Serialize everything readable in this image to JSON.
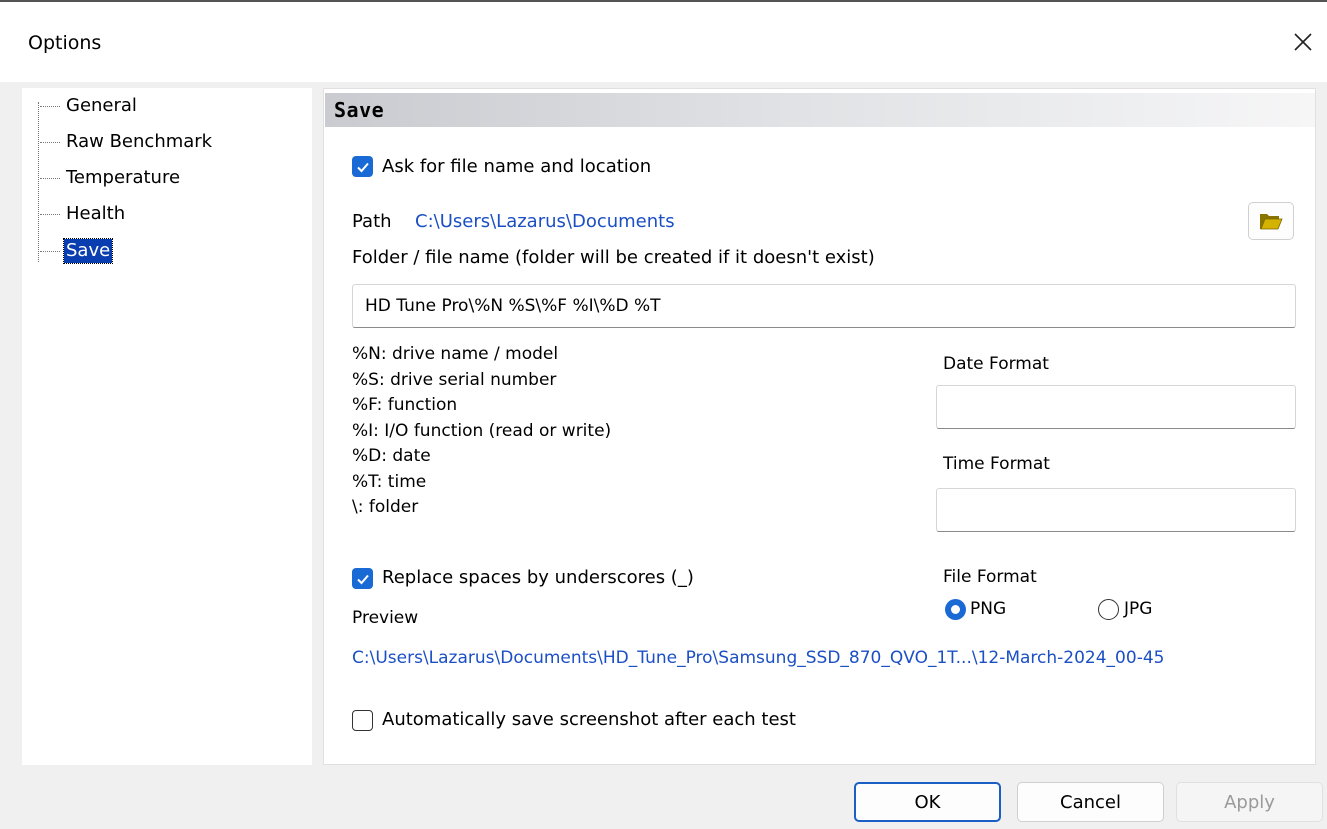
{
  "window": {
    "title": "Options"
  },
  "tree": {
    "items": [
      {
        "label": "General"
      },
      {
        "label": "Raw Benchmark"
      },
      {
        "label": "Temperature"
      },
      {
        "label": "Health"
      },
      {
        "label": "Save"
      }
    ],
    "selected": "Save"
  },
  "panel": {
    "title": "Save",
    "ask_label": "Ask for file name and location",
    "ask_checked": true,
    "path_label": "Path",
    "path_value": "C:\\Users\\Lazarus\\Documents",
    "folder_label": "Folder / file name (folder will be created if it doesn't exist)",
    "folder_value": "HD Tune Pro\\%N %S\\%F %I\\%D %T",
    "vars": [
      "%N: drive name / model",
      "%S: drive serial number",
      "%F: function",
      "%I: I/O function (read or write)",
      "%D: date",
      "%T: time",
      "\\: folder"
    ],
    "date_format_label": "Date Format",
    "date_format_value": "",
    "time_format_label": "Time Format",
    "time_format_value": "",
    "replace_label": "Replace spaces by underscores (_)",
    "replace_checked": true,
    "file_format_label": "File Format",
    "file_format_options": [
      "PNG",
      "JPG"
    ],
    "file_format_selected": "PNG",
    "preview_label": "Preview",
    "preview_value": "C:\\Users\\Lazarus\\Documents\\HD_Tune_Pro\\Samsung_SSD_870_QVO_1T...\\12-March-2024_00-45",
    "auto_save_label": "Automatically save screenshot after each test",
    "auto_save_checked": false
  },
  "buttons": {
    "ok": "OK",
    "cancel": "Cancel",
    "apply": "Apply"
  },
  "colors": {
    "accent": "#1a6ad6",
    "link": "#1b4fc4",
    "selection": "#0a3db0",
    "folder_icon": "#c8a800"
  }
}
